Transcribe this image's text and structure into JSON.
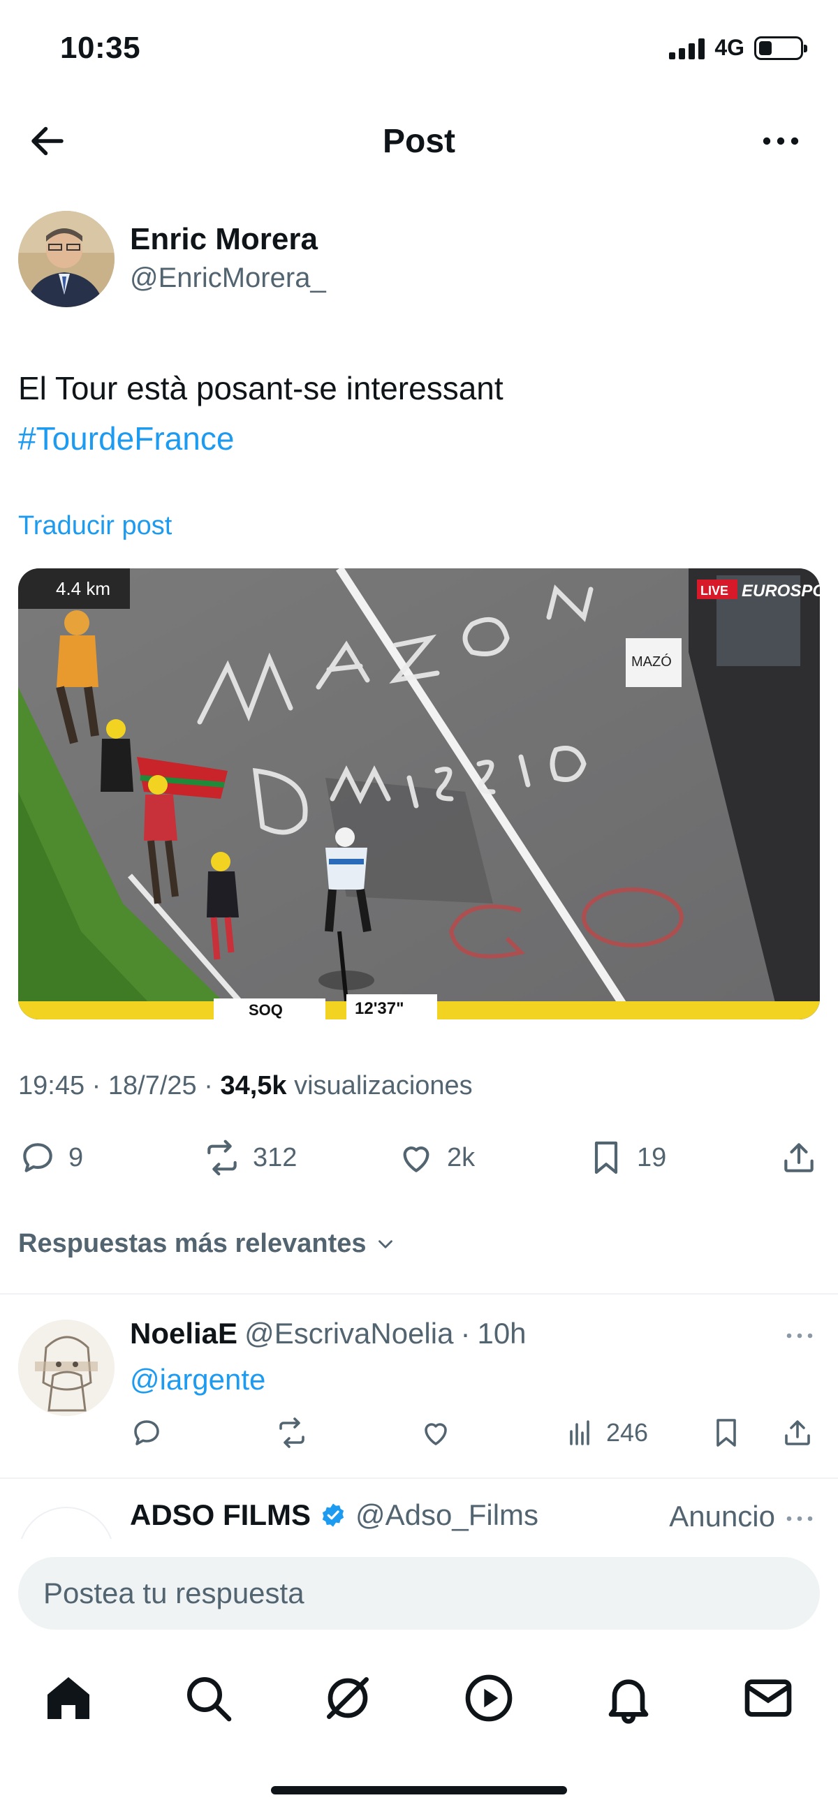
{
  "status_bar": {
    "time": "10:35",
    "network": "4G",
    "battery_fraction": 0.3
  },
  "header": {
    "title": "Post"
  },
  "post": {
    "author_name": "Enric Morera",
    "author_handle": "@EnricMorera_",
    "text": "El Tour està posant-se interessant",
    "hashtag": "#TourdeFrance",
    "translate_label": "Traducir post",
    "media": {
      "distance": "4.4 km",
      "live_badge": "LIVE",
      "broadcaster": "EUROSPO",
      "road_text_1": "MAZÓN",
      "road_text_2": "DIMISSIÓ",
      "road_text_3": "GO",
      "sign_text": "MAZÓ",
      "country_code": "SOQ",
      "time_gap": "12'37\""
    },
    "time": "19:45",
    "date": "18/7/25",
    "views_count": "34,5k",
    "views_label": "visualizaciones",
    "sep": "·",
    "replies": "9",
    "reposts": "312",
    "likes": "2k",
    "bookmarks": "19"
  },
  "replies_filter": "Respuestas más relevantes",
  "reply": {
    "name": "NoeliaE",
    "handle": "@EscrivaNoelia",
    "sep": "·",
    "age": "10h",
    "text": "@iargente",
    "views": "246"
  },
  "ad": {
    "name": "ADSO FILMS",
    "handle": "@Adso_Films",
    "label": "Anuncio"
  },
  "composer": {
    "placeholder": "Postea tu respuesta"
  },
  "colors": {
    "accent": "#1d9bf0",
    "text": "#0f1419",
    "muted": "#536471",
    "verified": "#1d9bf0"
  },
  "nav": [
    "home-icon",
    "search-icon",
    "grok-icon",
    "video-icon",
    "notifications-icon",
    "messages-icon"
  ]
}
